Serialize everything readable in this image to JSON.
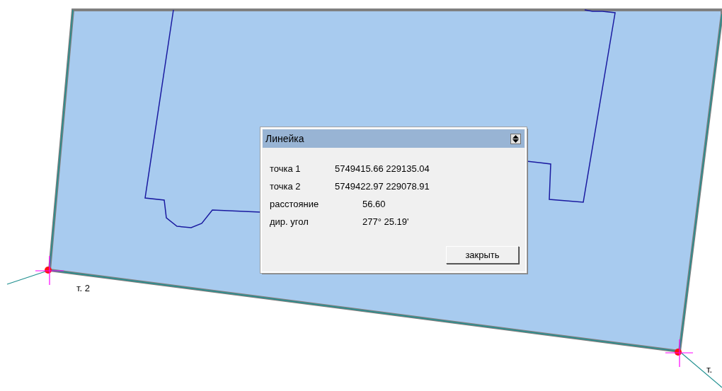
{
  "map": {
    "point_labels": [
      {
        "text": "т. 2"
      },
      {
        "text": "т."
      }
    ]
  },
  "dialog": {
    "title": "Линейка",
    "rows": [
      {
        "kind": "point",
        "label": "точка 1",
        "value": "5749415.66 229135.04"
      },
      {
        "kind": "point",
        "label": "точка 2",
        "value": "5749422.97 229078.91"
      },
      {
        "kind": "measure",
        "label": "расстояние",
        "value": "56.60"
      },
      {
        "kind": "measure",
        "label": "дир. угол",
        "value": "277° 25.19'"
      }
    ],
    "close_button": "закрыть"
  }
}
